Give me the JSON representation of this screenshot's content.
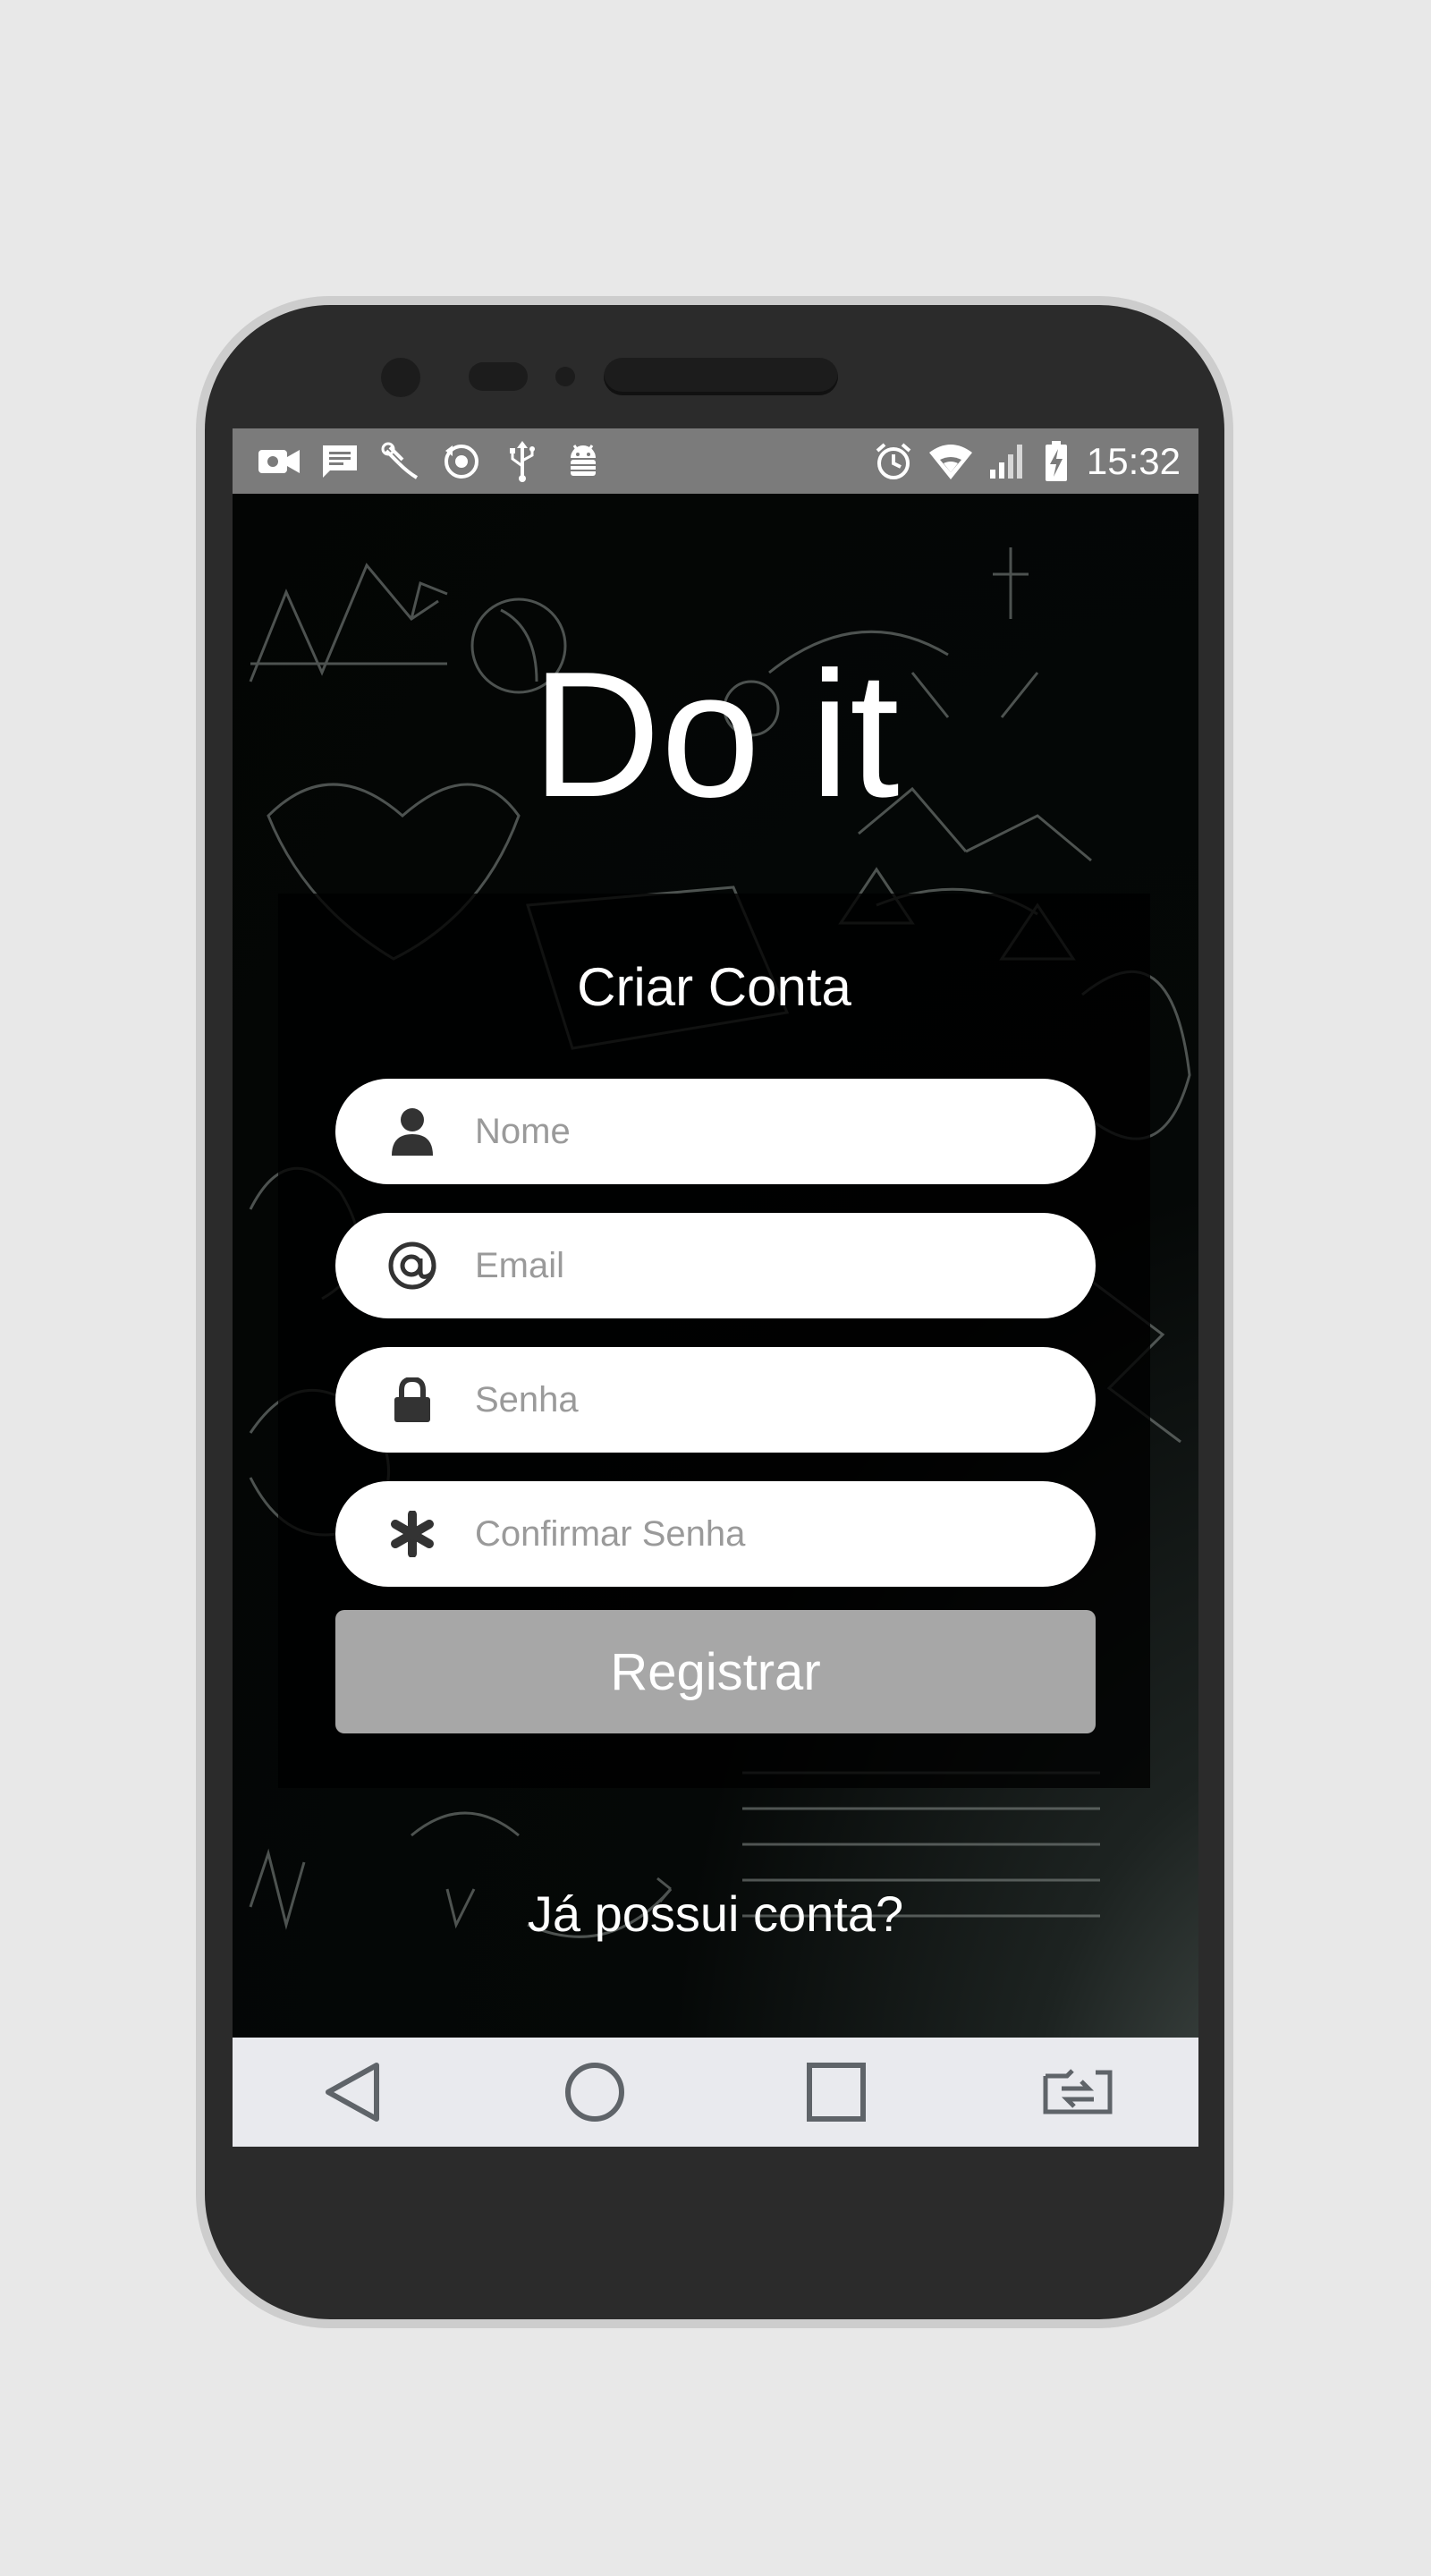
{
  "status_bar": {
    "time": "15:32",
    "left_icons": [
      "video-record-icon",
      "message-icon",
      "usb-tethering-icon",
      "sync-icon",
      "usb-icon",
      "android-debug-icon"
    ],
    "right_icons": [
      "alarm-icon",
      "wifi-icon",
      "signal-icon",
      "battery-charging-icon"
    ]
  },
  "app": {
    "title": "Do it"
  },
  "form": {
    "title": "Criar Conta",
    "fields": [
      {
        "placeholder": "Nome",
        "icon": "user-icon",
        "value": ""
      },
      {
        "placeholder": "Email",
        "icon": "at-icon",
        "value": ""
      },
      {
        "placeholder": "Senha",
        "icon": "lock-icon",
        "value": ""
      },
      {
        "placeholder": "Confirmar Senha",
        "icon": "asterisk-icon",
        "value": ""
      }
    ],
    "submit_label": "Registrar"
  },
  "login_link": "Já possui conta?",
  "nav_bar": {
    "buttons": [
      "back-icon",
      "home-icon",
      "recents-icon",
      "screen-rotate-icon"
    ]
  },
  "colors": {
    "background": "#050807",
    "status_bar": "#7b7b7b",
    "button": "#a7a7a7",
    "field": "#ffffff",
    "nav_bar": "#e9eaee"
  }
}
